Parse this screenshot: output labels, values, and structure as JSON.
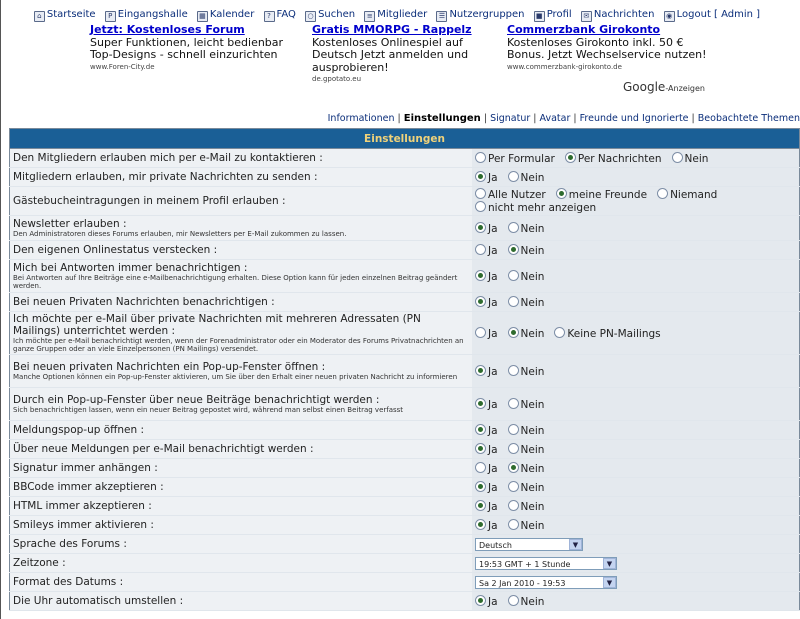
{
  "nav": {
    "items": [
      {
        "label": "Startseite"
      },
      {
        "label": "Eingangshalle"
      },
      {
        "label": "Kalender"
      },
      {
        "label": "FAQ"
      },
      {
        "label": "Suchen"
      },
      {
        "label": "Mitglieder"
      },
      {
        "label": "Nutzergruppen"
      },
      {
        "label": "Profil"
      },
      {
        "label": "Nachrichten"
      },
      {
        "label": "Logout [ Admin ]"
      }
    ]
  },
  "ads": [
    {
      "title": "Jetzt: Kostenloses Forum",
      "text": "Super Funktionen, leicht bedienbar Top-Designs - schnell einzurichten",
      "url": "www.Foren-City.de"
    },
    {
      "title": "Gratis MMORPG - Rappelz",
      "text": "Kostenloses Onlinespiel auf Deutsch Jetzt anmelden und ausprobieren!",
      "url": "de.gpotato.eu"
    },
    {
      "title": "Commerzbank Girokonto",
      "text": "Kostenloses Girokonto inkl. 50 € Bonus. Jetzt Wechselservice nutzen!",
      "url": "www.commerzbank-girokonto.de"
    }
  ],
  "google_label": {
    "brand": "Google",
    "suffix": "-Anzeigen"
  },
  "subnav": {
    "items": [
      "Informationen",
      "Einstellungen",
      "Signatur",
      "Avatar",
      "Freunde und Ignorierte",
      "Beobachtete Themen"
    ],
    "separator": "|",
    "active": "Einstellungen"
  },
  "settings": {
    "header": "Einstellungen",
    "rows": [
      {
        "label": "Den Mitgliedern erlauben mich per e-Mail zu kontaktieren :",
        "options": [
          {
            "label": "Per Formular",
            "checked": false
          },
          {
            "label": "Per Nachrichten",
            "checked": true
          },
          {
            "label": "Nein",
            "checked": false
          }
        ]
      },
      {
        "label": "Mitgliedern erlauben, mir private Nachrichten zu senden :",
        "options": [
          {
            "label": "Ja",
            "checked": true
          },
          {
            "label": "Nein",
            "checked": false
          }
        ]
      },
      {
        "label": "Gästebucheintragungen in meinem Profil erlauben :",
        "options": [
          {
            "label": "Alle Nutzer",
            "checked": false
          },
          {
            "label": "meine Freunde",
            "checked": true
          },
          {
            "label": "Niemand",
            "checked": false
          },
          {
            "label": "nicht mehr anzeigen",
            "checked": false
          }
        ]
      },
      {
        "label": "Newsletter erlauben :",
        "sub": "Den Administratoren dieses Forums erlauben, mir Newsletters per E-Mail zukommen zu lassen.",
        "options": [
          {
            "label": "Ja",
            "checked": true
          },
          {
            "label": "Nein",
            "checked": false
          }
        ]
      },
      {
        "label": "Den eigenen Onlinestatus verstecken :",
        "options": [
          {
            "label": "Ja",
            "checked": false
          },
          {
            "label": "Nein",
            "checked": true
          }
        ]
      },
      {
        "label": "Mich bei Antworten immer benachrichtigen :",
        "sub": "Bei Antworten auf Ihre Beiträge eine e-Mailbenachrichtigung erhalten. Diese Option kann für jeden einzelnen Beitrag geändert werden.",
        "options": [
          {
            "label": "Ja",
            "checked": true
          },
          {
            "label": "Nein",
            "checked": false
          }
        ]
      },
      {
        "label": "Bei neuen Privaten Nachrichten benachrichtigen :",
        "options": [
          {
            "label": "Ja",
            "checked": true
          },
          {
            "label": "Nein",
            "checked": false
          }
        ]
      },
      {
        "label": "Ich möchte per e-Mail über private Nachrichten mit mehreren Adressaten (PN Mailings) unterrichtet werden :",
        "sub": "Ich möchte per e-Mail benachrichtigt werden, wenn der Forenadministrator oder ein Moderator des Forums Privatnachrichten an ganze Gruppen oder an viele Einzelpersonen (PN Mailings) versendet.",
        "options": [
          {
            "label": "Ja",
            "checked": false
          },
          {
            "label": "Nein",
            "checked": true
          },
          {
            "label": "Keine PN-Mailings",
            "checked": false
          }
        ]
      },
      {
        "label": "Bei neuen privaten Nachrichten ein Pop-up-Fenster öffnen :",
        "sub": "Manche Optionen können ein Pop-up-Fenster aktivieren, um Sie über den Erhalt einer neuen privaten Nachricht zu informieren",
        "options": [
          {
            "label": "Ja",
            "checked": true
          },
          {
            "label": "Nein",
            "checked": false
          }
        ]
      },
      {
        "label": "Durch ein Pop-up-Fenster über neue Beiträge benachrichtigt werden :",
        "sub": "Sich benachrichtigen lassen, wenn ein neuer Beitrag gepostet wird, während man selbst einen Beitrag verfasst",
        "options": [
          {
            "label": "Ja",
            "checked": true
          },
          {
            "label": "Nein",
            "checked": false
          }
        ]
      },
      {
        "label": "Meldungspop-up öffnen :",
        "options": [
          {
            "label": "Ja",
            "checked": true
          },
          {
            "label": "Nein",
            "checked": false
          }
        ]
      },
      {
        "label": "Über neue Meldungen per e-Mail benachrichtigt werden :",
        "options": [
          {
            "label": "Ja",
            "checked": true
          },
          {
            "label": "Nein",
            "checked": false
          }
        ]
      },
      {
        "label": "Signatur immer anhängen :",
        "options": [
          {
            "label": "Ja",
            "checked": false
          },
          {
            "label": "Nein",
            "checked": true
          }
        ]
      },
      {
        "label": "BBCode immer akzeptieren :",
        "options": [
          {
            "label": "Ja",
            "checked": true
          },
          {
            "label": "Nein",
            "checked": false
          }
        ]
      },
      {
        "label": "HTML immer akzeptieren :",
        "options": [
          {
            "label": "Ja",
            "checked": true
          },
          {
            "label": "Nein",
            "checked": false
          }
        ]
      },
      {
        "label": "Smileys immer aktivieren :",
        "options": [
          {
            "label": "Ja",
            "checked": true
          },
          {
            "label": "Nein",
            "checked": false
          }
        ]
      },
      {
        "label": "Sprache des Forums :",
        "select": "Deutsch"
      },
      {
        "label": "Zeitzone :",
        "select": "19:53 GMT + 1 Stunde"
      },
      {
        "label": "Format des Datums :",
        "select": "Sa 2 Jan 2010 - 19:53"
      },
      {
        "label": "Die Uhr automatisch umstellen :",
        "options": [
          {
            "label": "Ja",
            "checked": true
          },
          {
            "label": "Nein",
            "checked": false
          }
        ]
      }
    ]
  }
}
